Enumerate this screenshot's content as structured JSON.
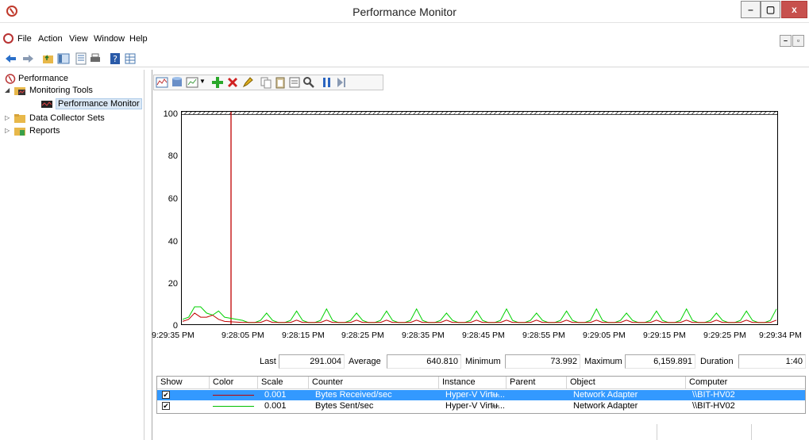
{
  "window": {
    "title": "Performance Monitor"
  },
  "menu": [
    "File",
    "Action",
    "View",
    "Window",
    "Help"
  ],
  "tree": [
    {
      "label": "Performance",
      "icon": "perfmon-icon"
    },
    {
      "label": "Monitoring Tools",
      "icon": "folder-chart-icon"
    },
    {
      "label": "Performance Monitor",
      "icon": "monitor-icon"
    },
    {
      "label": "Data Collector Sets",
      "icon": "folder-icon"
    },
    {
      "label": "Reports",
      "icon": "report-folder-icon"
    }
  ],
  "chart_data": {
    "type": "line",
    "ylim": [
      0,
      100
    ],
    "yticks": [
      "100",
      "80",
      "60",
      "40",
      "20",
      "0"
    ],
    "xticks": [
      "9:29:35 PM",
      "9:28:05 PM",
      "9:28:15 PM",
      "9:28:25 PM",
      "9:28:35 PM",
      "9:28:45 PM",
      "9:28:55 PM",
      "9:29:05 PM",
      "9:29:15 PM",
      "9:29:25 PM",
      "9:29:34 PM"
    ],
    "series": [
      {
        "name": "Bytes Received/sec",
        "color": "#c00000"
      },
      {
        "name": "Bytes Sent/sec",
        "color": "#00d000"
      }
    ]
  },
  "stats": {
    "last_label": "Last",
    "last": "291.004",
    "average_label": "Average",
    "average": "640.810",
    "minimum_label": "Minimum",
    "minimum": "73.992",
    "maximum_label": "Maximum",
    "maximum": "6,159.891",
    "duration_label": "Duration",
    "duration": "1:40"
  },
  "counters": {
    "headers": [
      "Show",
      "Color",
      "Scale",
      "Counter",
      "Instance",
      "Parent",
      "Object",
      "Computer"
    ],
    "rows": [
      {
        "show": "✔",
        "color": "#c00000",
        "scale": "0.001",
        "counter": "Bytes Received/sec",
        "instance": "Hyper-V Virtu...",
        "parent": "---",
        "object": "Network Adapter",
        "computer": "\\\\BIT-HV02"
      },
      {
        "show": "✔",
        "color": "#00c000",
        "scale": "0.001",
        "counter": "Bytes Sent/sec",
        "instance": "Hyper-V Virtu...",
        "parent": "---",
        "object": "Network Adapter",
        "computer": "\\\\BIT-HV02"
      }
    ]
  }
}
